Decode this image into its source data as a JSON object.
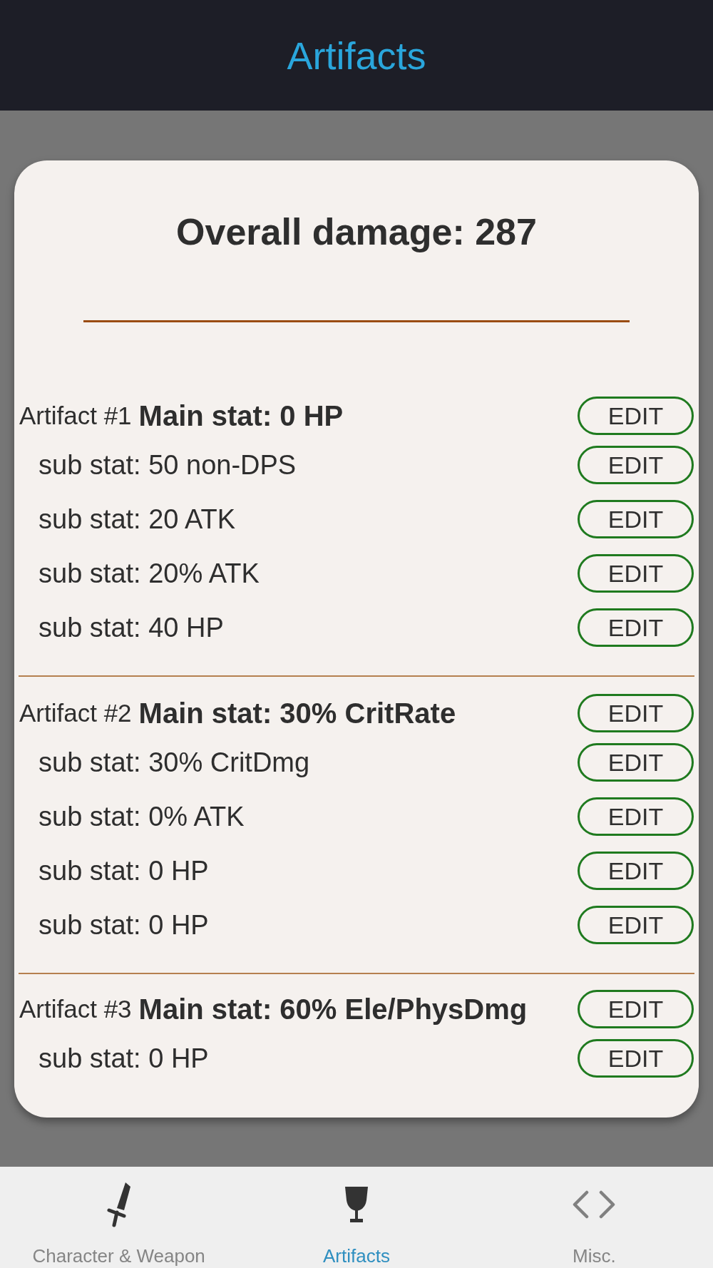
{
  "header": {
    "title": "Artifacts"
  },
  "summary": {
    "label": "Overall damage: 287"
  },
  "artifacts": [
    {
      "label": "Artifact #1",
      "main_stat": "Main stat: 0 HP",
      "button": "EDIT",
      "sub_stats": [
        {
          "label": "sub stat: 50 non-DPS",
          "button": "EDIT"
        },
        {
          "label": "sub stat: 20 ATK",
          "button": "EDIT"
        },
        {
          "label": "sub stat: 20% ATK",
          "button": "EDIT"
        },
        {
          "label": "sub stat: 40 HP",
          "button": "EDIT"
        }
      ]
    },
    {
      "label": "Artifact #2",
      "main_stat": "Main stat: 30% CritRate",
      "button": "EDIT",
      "sub_stats": [
        {
          "label": "sub stat: 30% CritDmg",
          "button": "EDIT"
        },
        {
          "label": "sub stat: 0% ATK",
          "button": "EDIT"
        },
        {
          "label": "sub stat: 0 HP",
          "button": "EDIT"
        },
        {
          "label": "sub stat: 0 HP",
          "button": "EDIT"
        }
      ]
    },
    {
      "label": "Artifact #3",
      "main_stat": "Main stat: 60% Ele/PhysDmg",
      "button": "EDIT",
      "sub_stats": [
        {
          "label": "sub stat: 0 HP",
          "button": "EDIT"
        }
      ]
    }
  ],
  "bottom_nav": [
    {
      "label": "Character & Weapon",
      "selected": false
    },
    {
      "label": "Artifacts",
      "selected": true
    },
    {
      "label": "Misc.",
      "selected": false
    }
  ]
}
